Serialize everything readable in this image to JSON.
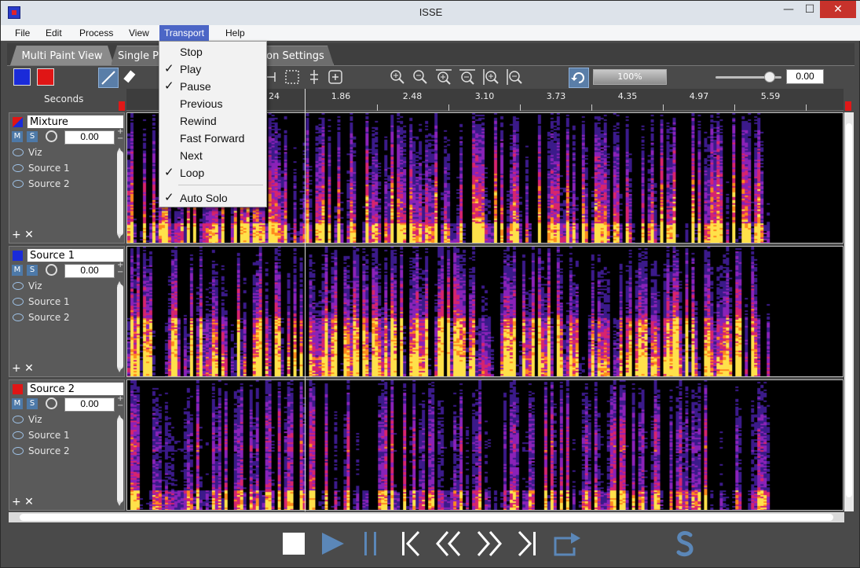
{
  "window": {
    "title": "ISSE",
    "controls": {
      "minimize": "—",
      "maximize": "☐",
      "close": "✕"
    }
  },
  "menubar": {
    "items": [
      "File",
      "Edit",
      "Process",
      "View",
      "Transport",
      "Help"
    ],
    "active": "Transport"
  },
  "tabs": [
    "Multi Paint View",
    "Single P",
    "on Settings"
  ],
  "toolbar": {
    "brush_colors": [
      "#1a2bd9",
      "#e01515"
    ],
    "zoom_percent": "100%",
    "value": "0.00"
  },
  "ruler": {
    "label": "Seconds",
    "ticks": [
      "24",
      "1.86",
      "2.48",
      "3.10",
      "3.73",
      "4.35",
      "4.97",
      "5.59"
    ]
  },
  "tracks": [
    {
      "name": "Mixture",
      "color": "mixed",
      "m": "M",
      "s": "S",
      "gain": "0.00",
      "rows": [
        "Viz",
        "Source 1",
        "Source 2"
      ]
    },
    {
      "name": "Source 1",
      "color": "#1a2bd9",
      "m": "M",
      "s": "S",
      "gain": "0.00",
      "rows": [
        "Viz",
        "Source 1",
        "Source 2"
      ]
    },
    {
      "name": "Source 2",
      "color": "#e01515",
      "m": "M",
      "s": "S",
      "gain": "0.00",
      "rows": [
        "Viz",
        "Source 1",
        "Source 2"
      ]
    }
  ],
  "transport_menu": {
    "items": [
      {
        "label": "Stop",
        "checked": false
      },
      {
        "label": "Play",
        "checked": true
      },
      {
        "label": "Pause",
        "checked": true
      },
      {
        "label": "Previous",
        "checked": false
      },
      {
        "label": "Rewind",
        "checked": false
      },
      {
        "label": "Fast Forward",
        "checked": false
      },
      {
        "label": "Next",
        "checked": false
      },
      {
        "label": "Loop",
        "checked": true
      },
      {
        "label": "Auto Solo",
        "checked": true
      }
    ],
    "check_glyph": "✓"
  },
  "icons": {
    "transport_bar": [
      "stop-icon",
      "play-icon",
      "pause-icon",
      "previous-icon",
      "rewind-icon",
      "fast-forward-icon",
      "next-icon",
      "loop-icon",
      "isse-logo-icon"
    ],
    "accent": "#5b87b8"
  }
}
